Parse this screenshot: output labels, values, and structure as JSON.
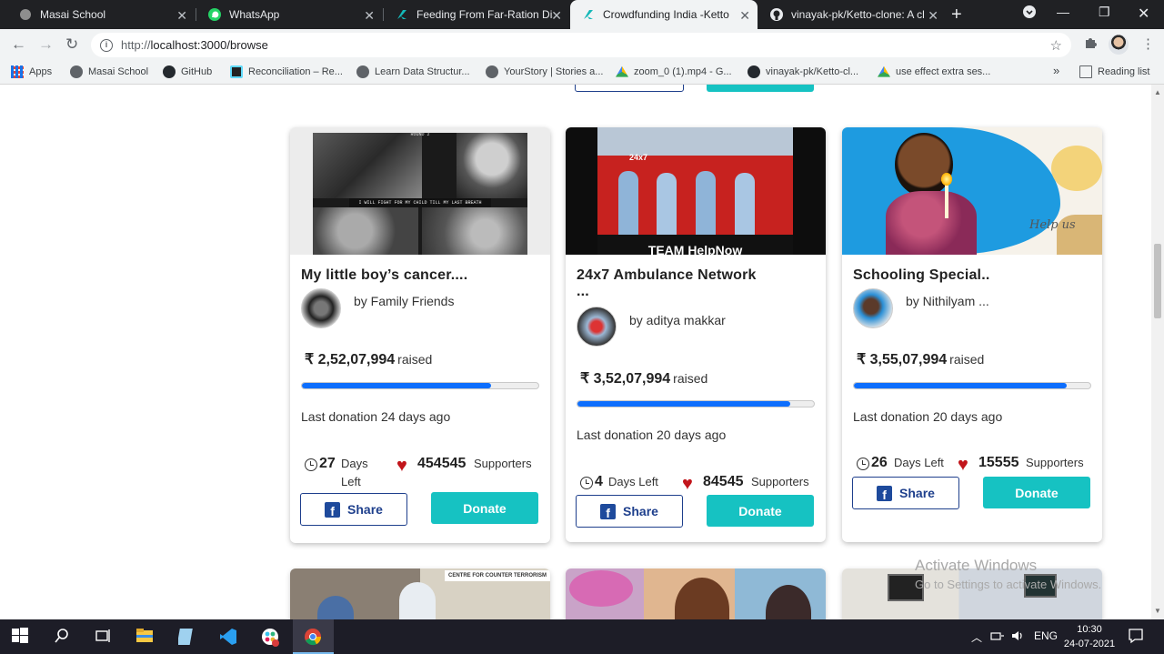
{
  "browser": {
    "tabs": [
      {
        "title": "Masai School",
        "active": false
      },
      {
        "title": "WhatsApp",
        "active": false
      },
      {
        "title": "Feeding From Far-Ration Dist",
        "active": false
      },
      {
        "title": "Crowdfunding India -Ketto",
        "active": true
      },
      {
        "title": "vinayak-pk/Ketto-clone: A cl",
        "active": false
      }
    ],
    "new_tab": "+",
    "url_scheme": "http://",
    "url_host": "localhost:3000/browse",
    "bookmarks": [
      {
        "label": "Apps",
        "icon": "apps-grid-icon"
      },
      {
        "label": "Masai School",
        "icon": "globe-icon"
      },
      {
        "label": "GitHub",
        "icon": "github-icon"
      },
      {
        "label": "Reconciliation – Re...",
        "icon": "react-icon"
      },
      {
        "label": "Learn Data Structur...",
        "icon": "globe-icon"
      },
      {
        "label": "YourStory | Stories a...",
        "icon": "globe-icon"
      },
      {
        "label": "zoom_0 (1).mp4 - G...",
        "icon": "google-drive-icon"
      },
      {
        "label": "vinayak-pk/Ketto-cl...",
        "icon": "github-icon"
      },
      {
        "label": "use effect extra ses...",
        "icon": "google-drive-icon"
      }
    ],
    "more_bookmarks": "»",
    "reading_list": "Reading list"
  },
  "cards": [
    {
      "title": "My little boy’s cancer....",
      "title_extra": "",
      "by": "by Family Friends",
      "currency": "₹",
      "amount": "2,52,07,994",
      "raised": "raised",
      "progress": 0.8,
      "last_donation": "Last donation 24 days ago",
      "days_num": "27",
      "days_label": "Days",
      "days_label2": "Left",
      "supporters_num": "454545",
      "supporters_label": "Supporters",
      "share": "Share",
      "donate": "Donate"
    },
    {
      "title": "24x7 Ambulance Network",
      "title_extra": "...",
      "by": "by aditya makkar",
      "currency": "₹",
      "amount": "3,52,07,994",
      "raised": "raised",
      "progress": 0.9,
      "last_donation": "Last donation 20 days ago",
      "days_num": "4",
      "days_label": "Days Left",
      "days_label2": "",
      "supporters_num": "84545",
      "supporters_label": "Supporters",
      "share": "Share",
      "donate": "Donate"
    },
    {
      "title": "Schooling Special..",
      "title_extra": "",
      "by": "by Nithilyam ...",
      "currency": "₹",
      "amount": "3,55,07,994",
      "raised": "raised",
      "progress": 0.9,
      "last_donation": "Last donation 20 days ago",
      "days_num": "26",
      "days_label": "Days Left",
      "days_label2": "",
      "supporters_num": "15555",
      "supporters_label": "Supporters",
      "share": "Share",
      "donate": "Donate"
    }
  ],
  "image_text": {
    "card1_top": "ROUND 2",
    "card1_caption": "I WILL FIGHT FOR MY CHILD TILL MY LAST BREATH",
    "card2_banner": "TEAM HelpNow",
    "card2_van_label": "24x7",
    "card3_overlay": "Help us",
    "next_row_sign": "CENTRE FOR COUNTER TERRORISM"
  },
  "watermark": {
    "line1": "Activate Windows",
    "line2": "Go to Settings to activate Windows."
  },
  "taskbar": {
    "language": "ENG",
    "time": "10:30",
    "date": "24-07-2021"
  }
}
